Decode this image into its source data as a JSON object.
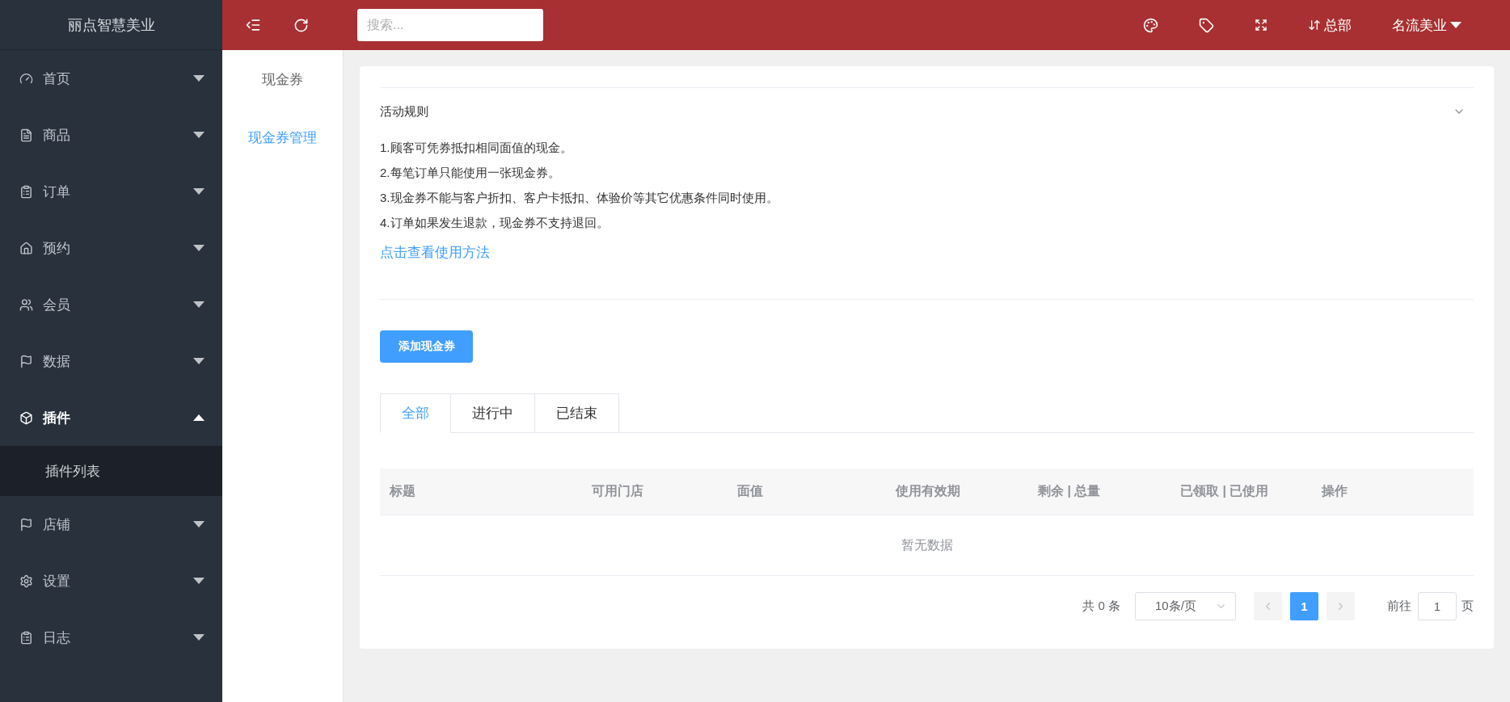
{
  "brand": "丽点智慧美业",
  "top_bar": {
    "search": {
      "placeholder": "搜索..."
    },
    "branch": "总部",
    "account": "名流美业"
  },
  "sidebar": {
    "items": [
      {
        "label": "首页",
        "expanded": false
      },
      {
        "label": "商品",
        "expanded": false
      },
      {
        "label": "订单",
        "expanded": false
      },
      {
        "label": "预约",
        "expanded": false
      },
      {
        "label": "会员",
        "expanded": false
      },
      {
        "label": "数据",
        "expanded": false
      },
      {
        "label": "插件",
        "expanded": true,
        "children": [
          {
            "label": "插件列表",
            "selected": true
          }
        ]
      },
      {
        "label": "店铺",
        "expanded": false
      },
      {
        "label": "设置",
        "expanded": false
      },
      {
        "label": "日志",
        "expanded": false
      }
    ]
  },
  "sub_menu": {
    "title": "现金券",
    "items": [
      {
        "label": "现金券管理",
        "selected": true
      }
    ]
  },
  "rules": {
    "title": "活动规则",
    "expanded": true,
    "lines": [
      "1.顾客可凭券抵扣相同面值的现金。",
      "2.每笔订单只能使用一张现金券。",
      "3.现金券不能与客户折扣、客户卡抵扣、体验价等其它优惠条件同时使用。",
      "4.订单如果发生退款，现金券不支持退回。"
    ],
    "link": "点击查看使用方法"
  },
  "add_button": "添加现金券",
  "tabs": [
    {
      "label": "全部",
      "selected": true
    },
    {
      "label": "进行中",
      "selected": false
    },
    {
      "label": "已结束",
      "selected": false
    }
  ],
  "table": {
    "columns": [
      "标题",
      "可用门店",
      "面值",
      "使用有效期",
      "剩余 | 总量",
      "已领取 | 已使用",
      "操作"
    ],
    "empty_text": "暂无数据"
  },
  "pagination": {
    "total": "共 0 条",
    "page_size": "10条/页",
    "pages": [
      {
        "label": "1",
        "selected": true
      }
    ],
    "goto_label": "前往",
    "goto_value": "1",
    "goto_suffix": "页"
  }
}
